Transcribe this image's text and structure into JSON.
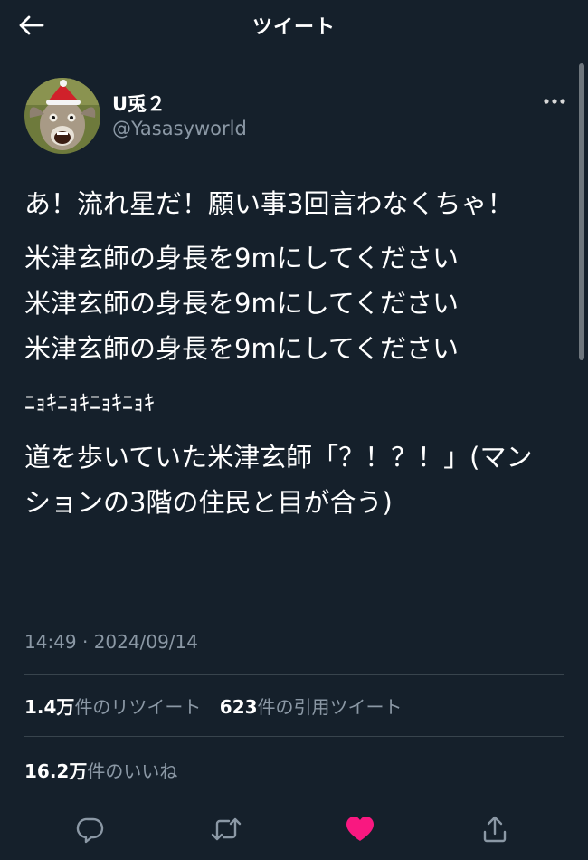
{
  "header": {
    "title": "ツイート"
  },
  "author": {
    "display_name": "U兎２",
    "handle": "@Yasasyworld"
  },
  "tweet": {
    "paragraphs": [
      "あ！流れ星だ！願い事3回言わなくちゃ！",
      "米津玄師の身長を9mにしてください\n米津玄師の身長を9mにしてください\n米津玄師の身長を9mにしてください",
      "ﾆｮｷﾆｮｷﾆｮｷﾆｮｷ",
      "道を歩いていた米津玄師「？！？！」(マンションの3階の住民と目が合う)"
    ],
    "timestamp": "14:49 · 2024/09/14"
  },
  "stats": {
    "retweets_count": "1.4万",
    "retweets_label": "件のリツイート",
    "quotes_count": "623",
    "quotes_label": "件の引用ツイート",
    "likes_count": "16.2万",
    "likes_label": "件のいいね"
  },
  "icons": {
    "back": "arrow-left-icon",
    "more": "more-icon",
    "reply": "reply-icon",
    "retweet": "retweet-icon",
    "like": "heart-filled-icon",
    "share": "share-icon"
  },
  "colors": {
    "background": "#15202b",
    "text": "#ffffff",
    "secondary_text": "#8b98a5",
    "divider": "#38444d",
    "like": "#f91880"
  }
}
